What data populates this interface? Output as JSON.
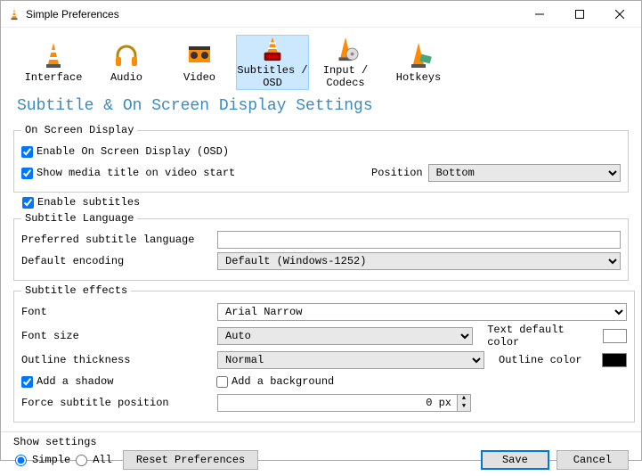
{
  "window": {
    "title": "Simple Preferences"
  },
  "tabs": {
    "interface": "Interface",
    "audio": "Audio",
    "video": "Video",
    "subtitles": "Subtitles / OSD",
    "input": "Input / Codecs",
    "hotkeys": "Hotkeys"
  },
  "section_title": "Subtitle & On Screen Display Settings",
  "osd": {
    "legend": "On Screen Display",
    "enable_osd": "Enable On Screen Display (OSD)",
    "show_title": "Show media title on video start",
    "position_label": "Position",
    "position_value": "Bottom"
  },
  "enable_subtitles": "Enable subtitles",
  "sub_lang": {
    "legend": "Subtitle Language",
    "preferred": "Preferred subtitle language",
    "preferred_value": "",
    "encoding": "Default encoding",
    "encoding_value": "Default (Windows-1252)"
  },
  "effects": {
    "legend": "Subtitle effects",
    "font": "Font",
    "font_value": "Arial Narrow",
    "font_size": "Font size",
    "font_size_value": "Auto",
    "text_color_label": "Text default color",
    "text_color": "#ffffff",
    "outline_thickness": "Outline thickness",
    "outline_thickness_value": "Normal",
    "outline_color_label": "Outline color",
    "outline_color": "#000000",
    "add_shadow": "Add a shadow",
    "add_background": "Add a background",
    "force_position": "Force subtitle position",
    "force_position_value": "0 px"
  },
  "footer": {
    "show_settings": "Show settings",
    "simple": "Simple",
    "all": "All",
    "reset": "Reset Preferences",
    "save": "Save",
    "cancel": "Cancel"
  }
}
